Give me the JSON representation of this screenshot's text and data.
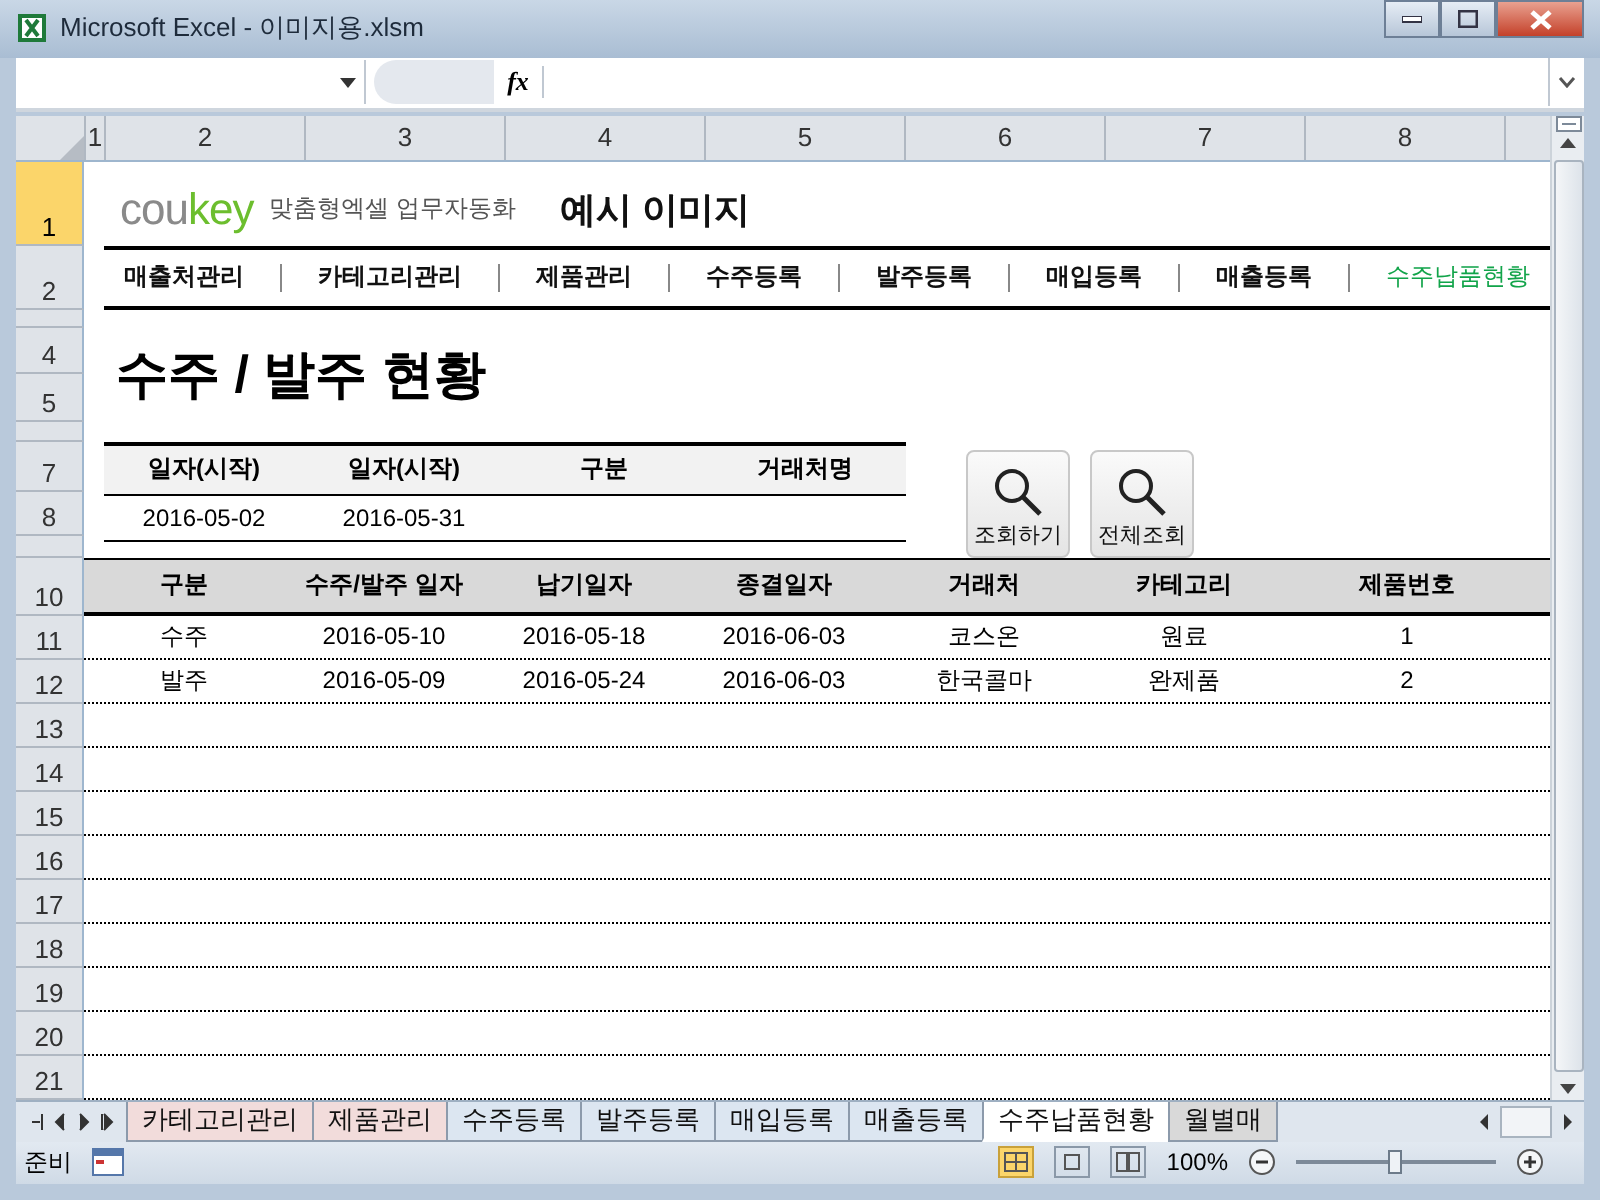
{
  "window": {
    "title": "Microsoft Excel - 이미지용.xlsm"
  },
  "formula_bar": {
    "function_label": "fx"
  },
  "column_headers": [
    "1",
    "2",
    "3",
    "4",
    "5",
    "6",
    "7",
    "8"
  ],
  "row_headers": [
    {
      "label": "1",
      "selected": true
    },
    {
      "label": "2",
      "selected": false
    },
    {
      "selected": false
    },
    {
      "label": "4",
      "selected": false
    },
    {
      "label": "5",
      "selected": false
    },
    {
      "selected": false
    },
    {
      "label": "7",
      "selected": false
    },
    {
      "label": "8",
      "selected": false
    },
    {
      "selected": false
    },
    {
      "label": "10",
      "selected": false
    },
    {
      "label": "11",
      "selected": false
    },
    {
      "label": "12",
      "selected": false
    },
    {
      "label": "13",
      "selected": false
    },
    {
      "label": "14",
      "selected": false
    },
    {
      "label": "15",
      "selected": false
    },
    {
      "label": "16",
      "selected": false
    },
    {
      "label": "17",
      "selected": false
    },
    {
      "label": "18",
      "selected": false
    },
    {
      "label": "19",
      "selected": false
    },
    {
      "label": "20",
      "selected": false
    },
    {
      "label": "21",
      "selected": false
    }
  ],
  "logo": {
    "gray": "cou",
    "green": "key",
    "tagline": "맞춤형엑셀 업무자동화"
  },
  "sheet_title": "예시 이미지",
  "nav": [
    {
      "label": "매출처관리",
      "selected": false
    },
    {
      "label": "카테고리관리",
      "selected": false
    },
    {
      "label": "제품관리",
      "selected": false
    },
    {
      "label": "수주등록",
      "selected": false
    },
    {
      "label": "발주등록",
      "selected": false
    },
    {
      "label": "매입등록",
      "selected": false
    },
    {
      "label": "매출등록",
      "selected": false
    },
    {
      "label": "수주납품현황",
      "selected": true
    }
  ],
  "heading": "수주 / 발주 현황",
  "filters": [
    {
      "label": "일자(시작)",
      "value": "2016-05-02"
    },
    {
      "label": "일자(시작)",
      "value": "2016-05-31"
    },
    {
      "label": "구분"
    },
    {
      "label": "거래처명"
    }
  ],
  "buttons": [
    {
      "label": "조회하기"
    },
    {
      "label": "전체조회"
    }
  ],
  "table": {
    "columns": [
      "구분",
      "수주/발주 일자",
      "납기일자",
      "종결일자",
      "거래처",
      "카테고리",
      "제품번호"
    ],
    "rows": [
      [
        "수주",
        "2016-05-10",
        "2016-05-18",
        "2016-06-03",
        "코스온",
        "원료",
        "1"
      ],
      [
        "발주",
        "2016-05-09",
        "2016-05-24",
        "2016-06-03",
        "한국콜마",
        "완제품",
        "2"
      ]
    ]
  },
  "sheet_tabs": [
    {
      "label": "카테고리관리",
      "color": "#f2dcdb",
      "selected": false
    },
    {
      "label": "제품관리",
      "color": "#f2dcdb",
      "selected": false
    },
    {
      "label": "수주등록",
      "color": "#dce6f1",
      "selected": false
    },
    {
      "label": "발주등록",
      "color": "#dce6f1",
      "selected": false
    },
    {
      "label": "매입등록",
      "color": "#dce6f1",
      "selected": false
    },
    {
      "label": "매출등록",
      "color": "#dce6f1",
      "selected": false
    },
    {
      "label": "수주납품현황",
      "color": "#ffffff",
      "selected": true
    },
    {
      "label": "월별매",
      "color": "#d9d9d9",
      "selected": false
    }
  ],
  "status_bar": {
    "status": "준비",
    "zoom": "100%",
    "zoom_slider": {
      "level": 0.5
    }
  }
}
